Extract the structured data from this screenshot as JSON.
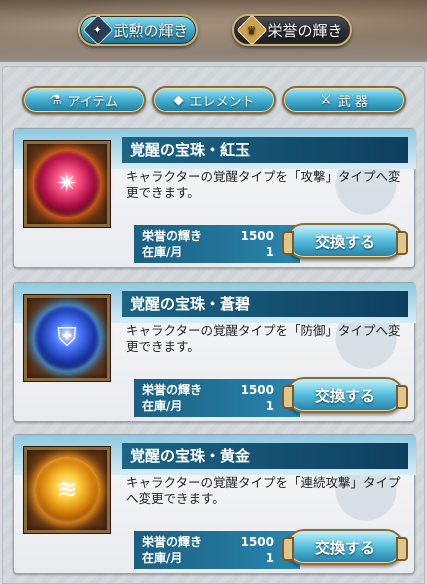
{
  "top_tabs": [
    {
      "label": "武勲の輝き",
      "icon": "diamond-icon",
      "active": true
    },
    {
      "label": "栄誉の輝き",
      "icon": "honor-icon",
      "active": false
    }
  ],
  "filters": [
    {
      "label": "アイテム",
      "icon": "potion-icon"
    },
    {
      "label": "エレメント",
      "icon": "element-icon"
    },
    {
      "label": "武 器",
      "icon": "crossed-swords-icon"
    }
  ],
  "items": [
    {
      "name": "覚醒の宝珠・紅玉",
      "description": "キャラクターの覚醒タイプを「攻撃」タイプへ変更できます。",
      "cost_label": "栄誉の輝き",
      "cost": "1500",
      "stock_label": "在庫/月",
      "stock": "1",
      "button": "交換する",
      "icon": "red-orb-icon",
      "color": "#b3124a"
    },
    {
      "name": "覚醒の宝珠・蒼碧",
      "description": "キャラクターの覚醒タイプを「防御」タイプへ変更できます。",
      "cost_label": "栄誉の輝き",
      "cost": "1500",
      "stock_label": "在庫/月",
      "stock": "1",
      "button": "交換する",
      "icon": "blue-orb-icon",
      "color": "#1a36a8"
    },
    {
      "name": "覚醒の宝珠・黄金",
      "description": "キャラクターの覚醒タイプを「連続攻撃」タイプへ変更できます。",
      "cost_label": "栄誉の輝き",
      "cost": "1500",
      "stock_label": "在庫/月",
      "stock": "1",
      "button": "交換する",
      "icon": "gold-orb-icon",
      "color": "#d07a08"
    }
  ]
}
